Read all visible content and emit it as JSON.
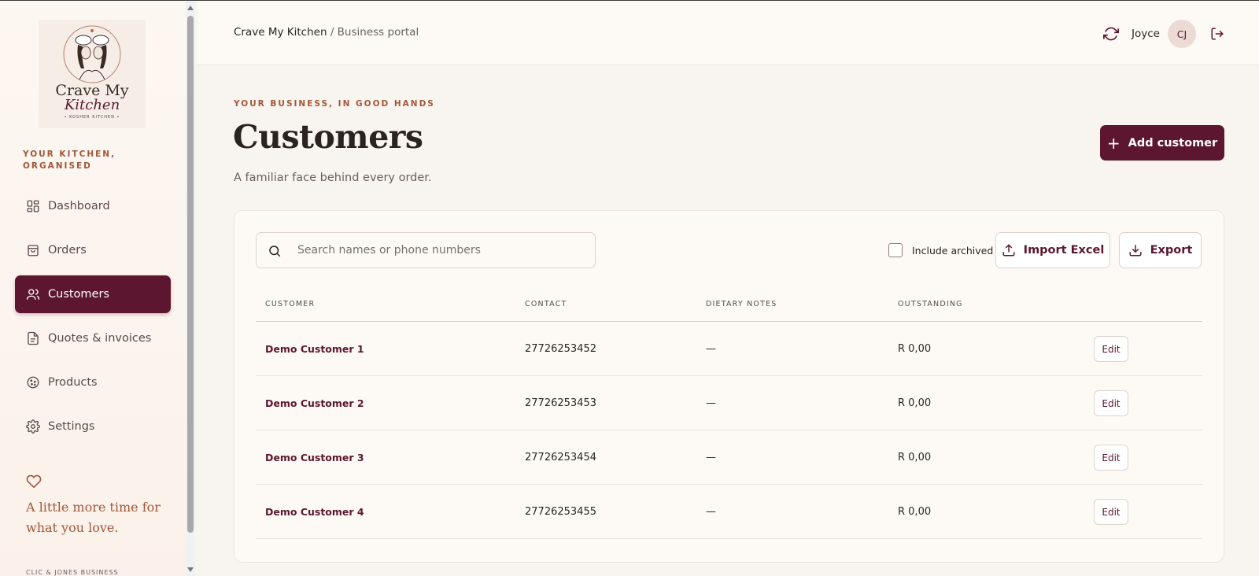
{
  "brand": {
    "name_line1": "Crave My",
    "name_line2": "Kitchen",
    "tag": "• KOSHER KITCHEN •",
    "eyebrow": "YOUR KITCHEN, ORGANISED",
    "tagline": "A little more time for what you love.",
    "cutoff_text": "CLIC & JONES BUSINESS"
  },
  "nav": {
    "items": [
      {
        "label": "Dashboard",
        "icon": "dashboard-icon",
        "active": false
      },
      {
        "label": "Orders",
        "icon": "shopping-bag-icon",
        "active": false
      },
      {
        "label": "Customers",
        "icon": "users-icon",
        "active": true
      },
      {
        "label": "Quotes & invoices",
        "icon": "document-icon",
        "active": false
      },
      {
        "label": "Products",
        "icon": "cookie-icon",
        "active": false
      },
      {
        "label": "Settings",
        "icon": "gear-icon",
        "active": false
      }
    ]
  },
  "header": {
    "breadcrumb_root": "Crave My Kitchen",
    "breadcrumb_sep": "/",
    "breadcrumb_current": "Business portal",
    "user_name": "Joyce",
    "user_initials": "CJ"
  },
  "page": {
    "eyebrow": "YOUR BUSINESS, IN GOOD HANDS",
    "title": "Customers",
    "subtitle": "A familiar face behind every order.",
    "add_label": "Add customer"
  },
  "toolbar": {
    "search_placeholder": "Search names or phone numbers",
    "search_value": "",
    "include_archived_label": "Include archived",
    "include_archived_checked": false,
    "import_label": "Import Excel",
    "export_label": "Export"
  },
  "table": {
    "columns": [
      "CUSTOMER",
      "CONTACT",
      "DIETARY NOTES",
      "OUTSTANDING"
    ],
    "edit_label": "Edit",
    "rows": [
      {
        "name": "Demo Customer 1",
        "contact": "27726253452",
        "dietary": "—",
        "outstanding": "R 0,00"
      },
      {
        "name": "Demo Customer 2",
        "contact": "27726253453",
        "dietary": "—",
        "outstanding": "R 0,00"
      },
      {
        "name": "Demo Customer 3",
        "contact": "27726253454",
        "dietary": "—",
        "outstanding": "R 0,00"
      },
      {
        "name": "Demo Customer 4",
        "contact": "27726253455",
        "dietary": "—",
        "outstanding": "R 0,00"
      }
    ]
  },
  "colors": {
    "brand": "#5c1630",
    "accent": "#a0573a",
    "background": "#f8f4ef"
  }
}
